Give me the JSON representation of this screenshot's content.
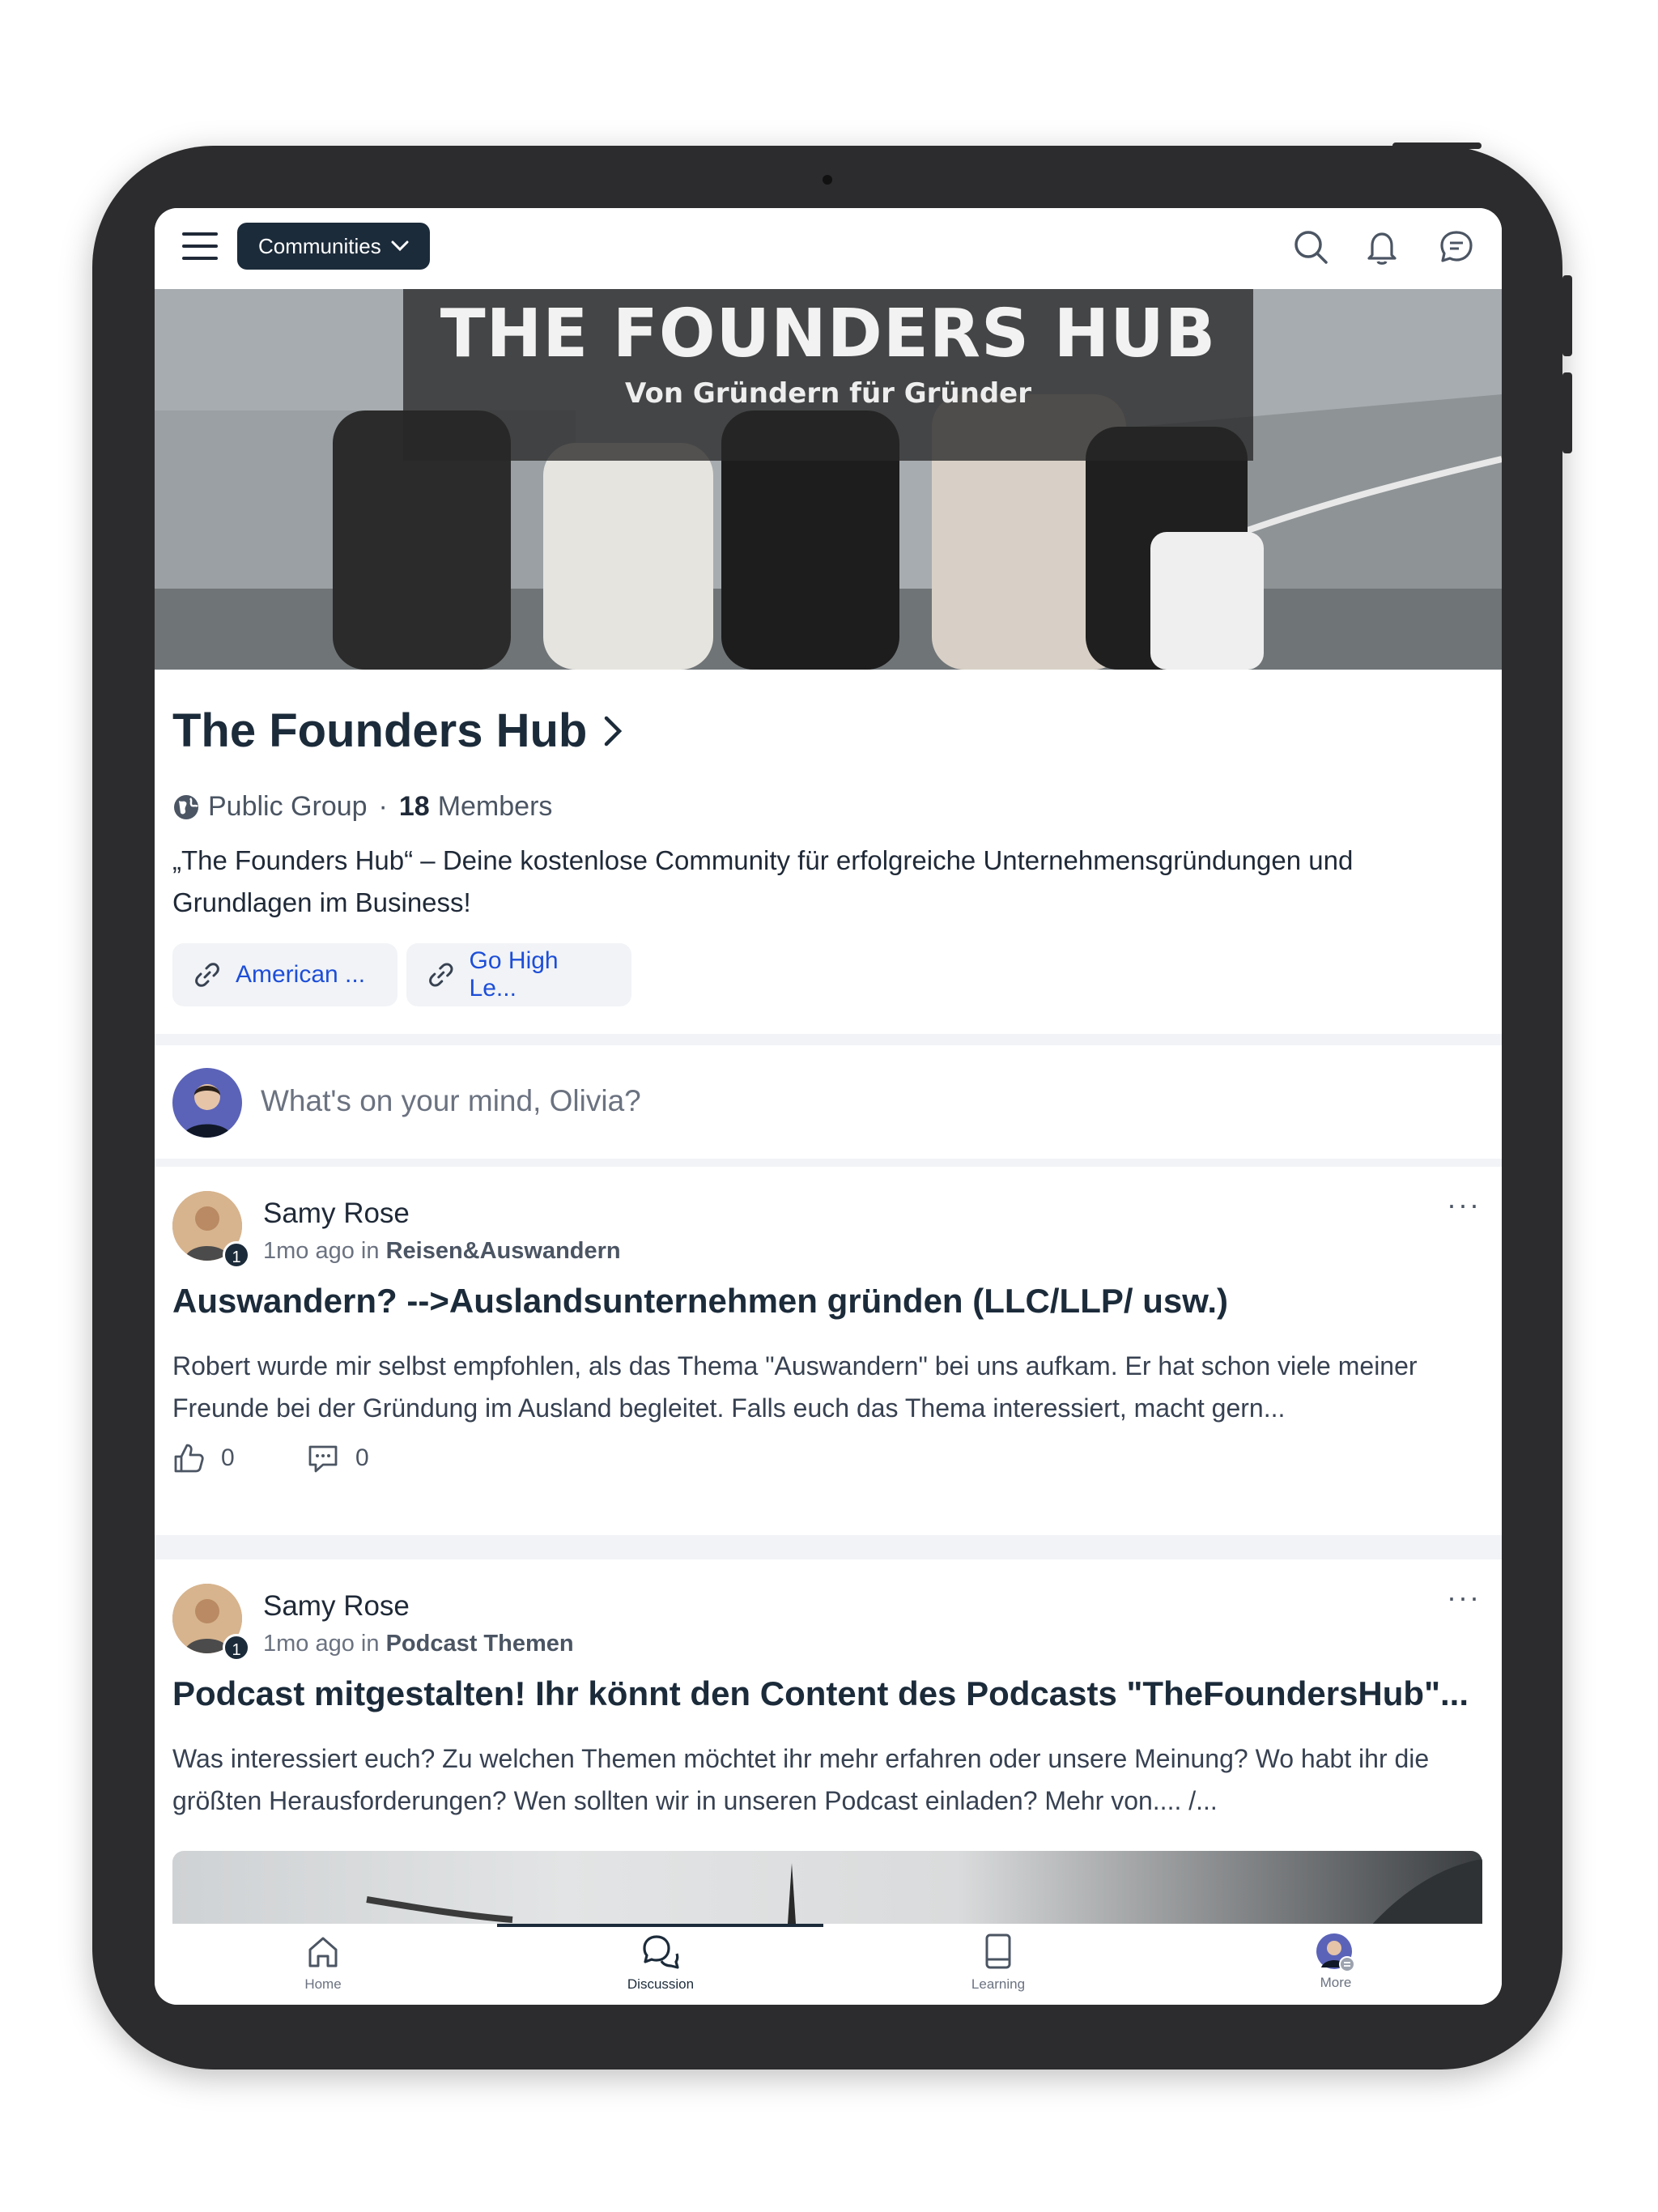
{
  "topbar": {
    "communities_label": "Communities",
    "icons": [
      "menu-icon",
      "search-icon",
      "bell-icon",
      "chat-icon"
    ]
  },
  "banner": {
    "title": "THE FOUNDERS HUB",
    "subtitle": "Von Gründern für Gründer"
  },
  "group": {
    "name": "The Founders Hub",
    "visibility": "Public Group",
    "separator": "·",
    "member_count": "18",
    "members_label": "Members",
    "description": "„The Founders Hub“ – Deine kostenlose Community für erfolgreiche Unternehmensgründungen und Grundlagen im Business!",
    "links": [
      {
        "label": "American ..."
      },
      {
        "label": "Go High Le..."
      }
    ]
  },
  "composer": {
    "placeholder": "What's on your mind, Olivia?"
  },
  "posts": [
    {
      "author": "Samy Rose",
      "badge": "1",
      "time": "1mo ago",
      "in_label": "in",
      "category": "Reisen&Auswandern",
      "title": "Auswandern? -->Auslandsunternehmen gründen (LLC/LLP/ usw.)",
      "body": "Robert wurde mir selbst empfohlen, als das Thema \"Auswandern\" bei uns aufkam. Er hat schon viele meiner Freunde bei der Gründung im Ausland begleitet. Falls euch das Thema interessiert, macht gern...",
      "likes": "0",
      "comments": "0",
      "more": "···"
    },
    {
      "author": "Samy Rose",
      "badge": "1",
      "time": "1mo ago",
      "in_label": "in",
      "category": "Podcast Themen",
      "title": "Podcast mitgestalten! Ihr könnt den Content des Podcasts \"TheFoundersHub\"...",
      "body": "Was interessiert euch? Zu welchen Themen möchtet ihr mehr erfahren oder unsere Meinung? Wo habt ihr die größten Herausforderungen? Wen sollten wir in unseren Podcast einladen? Mehr von.... /...",
      "more": "···"
    }
  ],
  "bottom_nav": [
    {
      "label": "Home",
      "icon": "home-icon"
    },
    {
      "label": "Discussion",
      "icon": "discussion-icon",
      "active": true
    },
    {
      "label": "Learning",
      "icon": "book-icon"
    },
    {
      "label": "More",
      "icon": "avatar"
    }
  ],
  "colors": {
    "primary": "#1c2b3a",
    "link": "#1d4ed8",
    "frame": "#2c2c2e"
  }
}
